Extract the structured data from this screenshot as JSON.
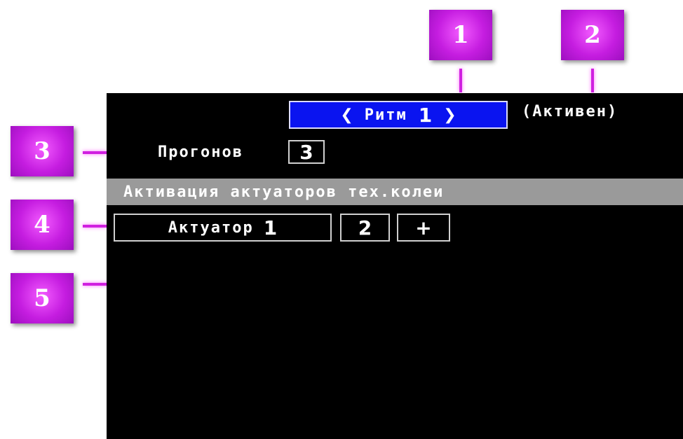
{
  "screen": {
    "rhythm": {
      "prev_icon": "chevron-left-icon",
      "name": "Ритм",
      "number": "1",
      "next_icon": "chevron-right-icon",
      "background": "#0a14f0"
    },
    "status": "(Активен)",
    "runs": {
      "label": "Прогонов",
      "value": "3"
    },
    "section_title": "Активация актуаторов тех.колеи",
    "actuators": [
      {
        "name": "Актуатор",
        "number": "1"
      },
      {
        "number": "2"
      }
    ],
    "add_label": "+"
  },
  "callouts": [
    "1",
    "2",
    "3",
    "4",
    "5"
  ],
  "colors": {
    "callout": "#c51de0",
    "leader": "#d020e0",
    "screen_bg": "#000000"
  }
}
